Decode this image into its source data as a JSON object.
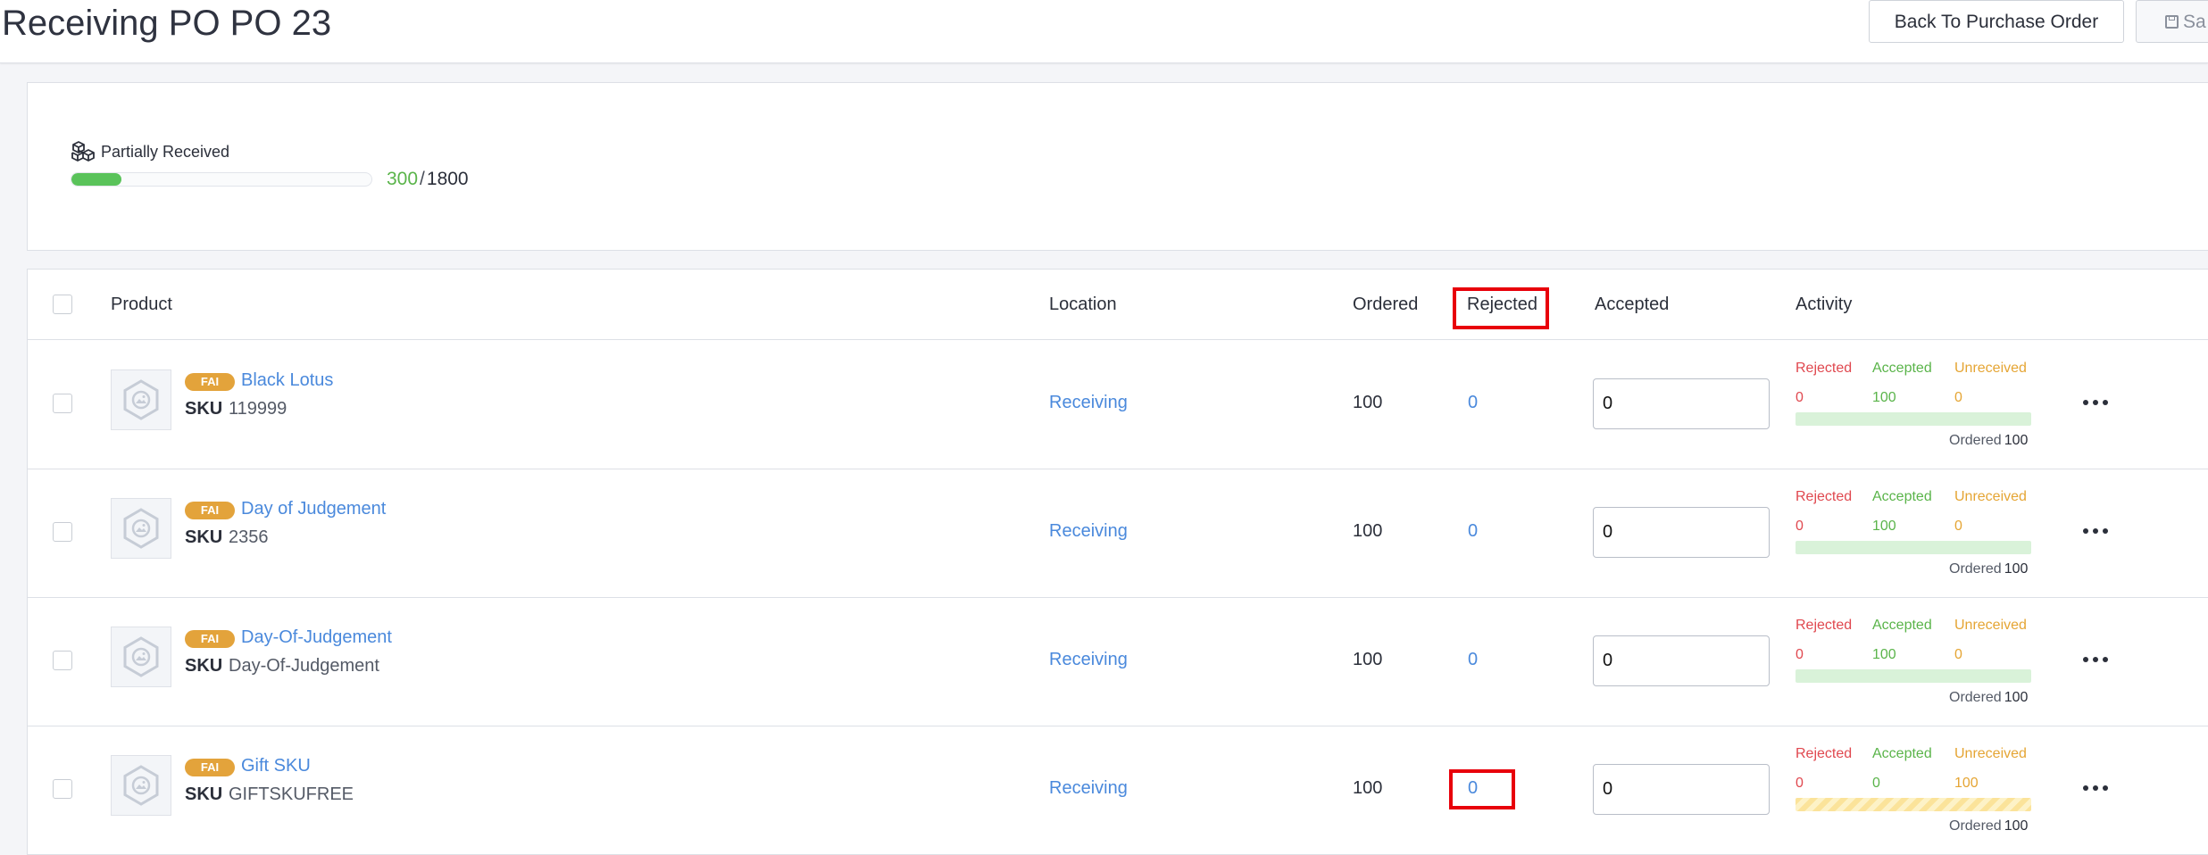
{
  "header": {
    "title": "Receiving PO PO 23",
    "back_button": "Back To Purchase Order",
    "save_button": "Sa"
  },
  "summary": {
    "status": "Partially Received",
    "received": "300",
    "separator": "/",
    "total": "1800",
    "progress_fraction": 0.167
  },
  "table": {
    "columns": [
      "Product",
      "Location",
      "Ordered",
      "Rejected",
      "Accepted",
      "Activity"
    ],
    "rows": [
      {
        "badge": "FAI",
        "name": "Black Lotus",
        "sku_label": "SKU",
        "sku": "119999",
        "location": "Receiving",
        "ordered": "100",
        "rejected": "0",
        "accepted": "0",
        "activity": {
          "rejected_label": "Rejected",
          "accepted_label": "Accepted",
          "unreceived_label": "Unreceived",
          "rejected": "0",
          "accepted": "100",
          "unreceived": "0",
          "ordered_label": "Ordered",
          "ordered": "100",
          "bar_state": "accepted"
        }
      },
      {
        "badge": "FAI",
        "name": "Day of Judgement",
        "sku_label": "SKU",
        "sku": "2356",
        "location": "Receiving",
        "ordered": "100",
        "rejected": "0",
        "accepted": "0",
        "activity": {
          "rejected_label": "Rejected",
          "accepted_label": "Accepted",
          "unreceived_label": "Unreceived",
          "rejected": "0",
          "accepted": "100",
          "unreceived": "0",
          "ordered_label": "Ordered",
          "ordered": "100",
          "bar_state": "accepted"
        }
      },
      {
        "badge": "FAI",
        "name": "Day-Of-Judgement",
        "sku_label": "SKU",
        "sku": "Day-Of-Judgement",
        "location": "Receiving",
        "ordered": "100",
        "rejected": "0",
        "accepted": "0",
        "activity": {
          "rejected_label": "Rejected",
          "accepted_label": "Accepted",
          "unreceived_label": "Unreceived",
          "rejected": "0",
          "accepted": "100",
          "unreceived": "0",
          "ordered_label": "Ordered",
          "ordered": "100",
          "bar_state": "accepted"
        }
      },
      {
        "badge": "FAI",
        "name": "Gift SKU",
        "sku_label": "SKU",
        "sku": "GIFTSKUFREE",
        "location": "Receiving",
        "ordered": "100",
        "rejected": "0",
        "accepted": "0",
        "activity": {
          "rejected_label": "Rejected",
          "accepted_label": "Accepted",
          "unreceived_label": "Unreceived",
          "rejected": "0",
          "accepted": "0",
          "unreceived": "100",
          "ordered_label": "Ordered",
          "ordered": "100",
          "bar_state": "unreceived"
        }
      }
    ]
  },
  "colors": {
    "link": "#4a89dc",
    "rejected": "#e0484f",
    "accepted": "#5ab44a",
    "unreceived": "#e5a534",
    "badge": "#e3a33b",
    "highlight": "#e8000a"
  }
}
